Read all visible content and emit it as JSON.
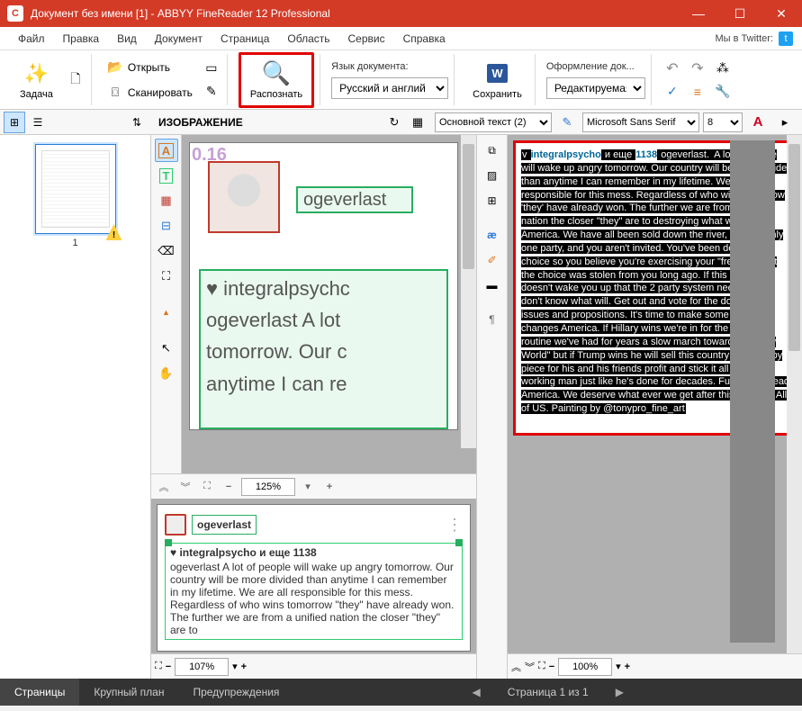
{
  "titlebar": {
    "title": "Документ без имени [1] - ABBYY FineReader 12 Professional",
    "app_glyph": "C"
  },
  "menubar": {
    "items": [
      "Файл",
      "Правка",
      "Вид",
      "Документ",
      "Страница",
      "Область",
      "Сервис",
      "Справка"
    ],
    "twitter_label": "Мы в Twitter:"
  },
  "toolbar": {
    "task": "Задача",
    "open": "Открыть",
    "scan": "Сканировать",
    "recognize": "Распознать",
    "lang_label": "Язык документа:",
    "lang_value": "Русский и англий",
    "save": "Сохранить",
    "layout_label": "Оформление док...",
    "layout_value": "Редактируемая"
  },
  "pages": {
    "page_number": "1"
  },
  "image_pane": {
    "header": "ИЗОБРАЖЕНИЕ",
    "overlay_num": "0.16",
    "zone1": "ogeverlast",
    "zone2_lines": [
      "♥ integralpsychc",
      "ogeverlast A lot",
      "tomorrow. Our c",
      "anytime I can re"
    ],
    "zoom": "125%"
  },
  "image_lower": {
    "user": "ogeverlast",
    "heart_line": "♥ integralpsycho и еще 1138",
    "body": "ogeverlast A lot of people will wake up angry tomorrow. Our country will be more divided than anytime I can remember in my lifetime. We are all responsible for this mess. Regardless of who wins tomorrow \"they\" have already won. The further we are from a unified nation the closer \"they\" are to",
    "zoom": "107%"
  },
  "text_pane": {
    "style_sel": "Основной текст (2)",
    "font_sel": "Microsoft Sans Serif",
    "size_sel": "8",
    "hilite_user": "integralpsycho",
    "hilite_mid": " и еще ",
    "hilite_num": "1138",
    "hilite_tail": " ogeverlast. ",
    "body": "A lot of people will wake up angry tomorrow. Our country will be more divided than anytime I can remember in my lifetime. We are all responsible for this mess. Regardless of who wins tomorrow 'they' have already won. The further we are from a unified nation the closer \"they\" are to destroying what was once America. We have all been sold down the river, there is only one party, and you aren't invited. You've been delivered a choice so you believe you're exercising your \"freedom\" but the choice was stolen from you long ago. If this election doesn't wake you up that the 2 party system needs to go I don't know what will. Get out and vote for the down ballot issues and propositions. It's time to make some REAL changes America. If Hillary wins we're in for the same old routine we've had for years a slow march toward the \"New World\" but if Trump wins he will sell this country off piece by piece for his and his friends profit and stick it all to the working man just like he's done for decades. Fun days ahead America. We deserve what ever we get after this election. All of US. Painting by @tonypro_fine_art",
    "zoom": "100%"
  },
  "statusbar": {
    "tabs": [
      "Страницы",
      "Крупный план",
      "Предупреждения"
    ],
    "paging": "Страница 1 из 1"
  }
}
